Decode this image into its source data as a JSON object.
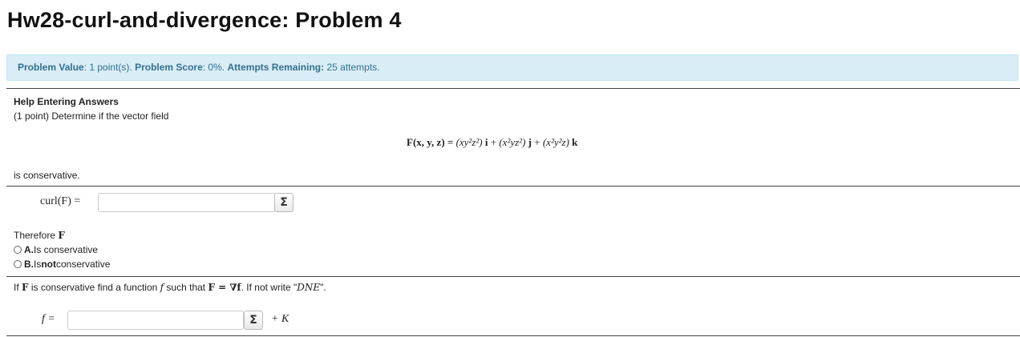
{
  "page": {
    "title": "Hw28-curl-and-divergence: Problem 4"
  },
  "info": {
    "value_label": "Problem Value",
    "value_text": ": 1 point(s). ",
    "score_label": "Problem Score",
    "score_text": ": 0%. ",
    "attempts_label": "Attempts Remaining:",
    "attempts_text": " 25 attempts."
  },
  "problem": {
    "help_link": "Help Entering Answers",
    "intro": "(1 point) Determine if the vector field",
    "formula": {
      "lhs": "F(x, y, z) = ",
      "term1": "(xy²z²)",
      "i": "i",
      "plus1": " + ",
      "term2": "(x²yz²)",
      "j": "j",
      "plus2": " + ",
      "term3": "(x²y²z)",
      "k": "k"
    },
    "is_conservative": "is conservative.",
    "curl_label": "curl(F) =",
    "curl_value": "",
    "therefore_prefix": "Therefore ",
    "therefore_F": "F",
    "options": [
      {
        "letter": "A.",
        "text": " Is conservative"
      },
      {
        "letter": "B.",
        "text_prefix": " Is ",
        "bold": "not",
        "text_suffix": " conservative"
      }
    ],
    "find_prefix": "If ",
    "find_F": "F",
    "find_mid": " is conservative find a function ",
    "find_f": "f",
    "find_mid2": " such that ",
    "find_eq": "F = ∇f",
    "find_suffix": ". If not write \"",
    "find_dne": "DNE",
    "find_end": "\".",
    "f_label": "f =",
    "f_value": "",
    "plus_k": "+ K"
  },
  "icons": {
    "equation_editor": "Σ"
  }
}
